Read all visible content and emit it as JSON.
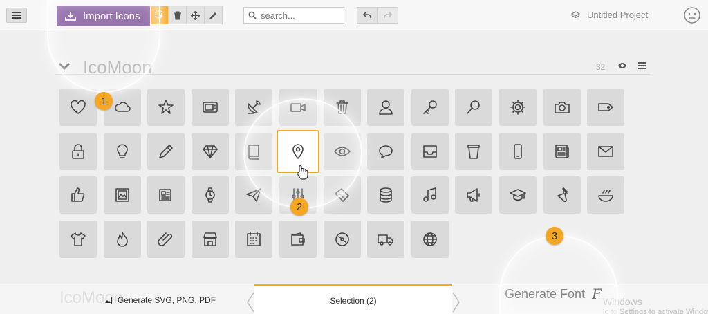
{
  "toolbar": {
    "import_label": "Import Icons",
    "search_placeholder": "search...",
    "project_name": "Untitled Project"
  },
  "set": {
    "title": "IcoMoon",
    "count": "32"
  },
  "icons": [
    "heart-icon",
    "cloud-icon",
    "star-icon",
    "tv-icon",
    "satellite-dish-icon",
    "video-camera-icon",
    "trash-icon",
    "user-icon",
    "key-icon",
    "magnifier-icon",
    "cog-icon",
    "camera-icon",
    "tag-icon",
    "lock-icon",
    "lightbulb-icon",
    "pencil-icon",
    "diamond-icon",
    "book-icon",
    "location-pin-icon",
    "eye-icon",
    "speech-bubble-icon",
    "inbox-icon",
    "coffee-cup-icon",
    "mobile-icon",
    "newspaper-icon",
    "envelope-icon",
    "thumbs-up-icon",
    "image-icon",
    "document-icon",
    "watch-icon",
    "paper-plane-icon",
    "equalizer-icon",
    "ticket-icon",
    "database-icon",
    "music-note-icon",
    "megaphone-icon",
    "graduation-cap-icon",
    "lab-flask-icon",
    "food-bowl-icon",
    "t-shirt-icon",
    "fire-icon",
    "paperclip-icon",
    "shop-icon",
    "calendar-icon",
    "wallet-icon",
    "disc-icon",
    "truck-icon",
    "globe-icon"
  ],
  "selected_icon": "location-pin-icon",
  "badges": [
    "1",
    "2",
    "3"
  ],
  "bottom": {
    "ghost_set": "IcoMoon",
    "generate_svg": "Generate SVG, PNG, PDF",
    "selection": "Selection (2)",
    "generate_font": "Generate Font",
    "font_glyph": "F",
    "watermark_line1": "Windows",
    "watermark_line2": "Go to Settings to activate Windows."
  },
  "colors": {
    "accent": "#f5a623",
    "brand": "#7b4e97"
  }
}
